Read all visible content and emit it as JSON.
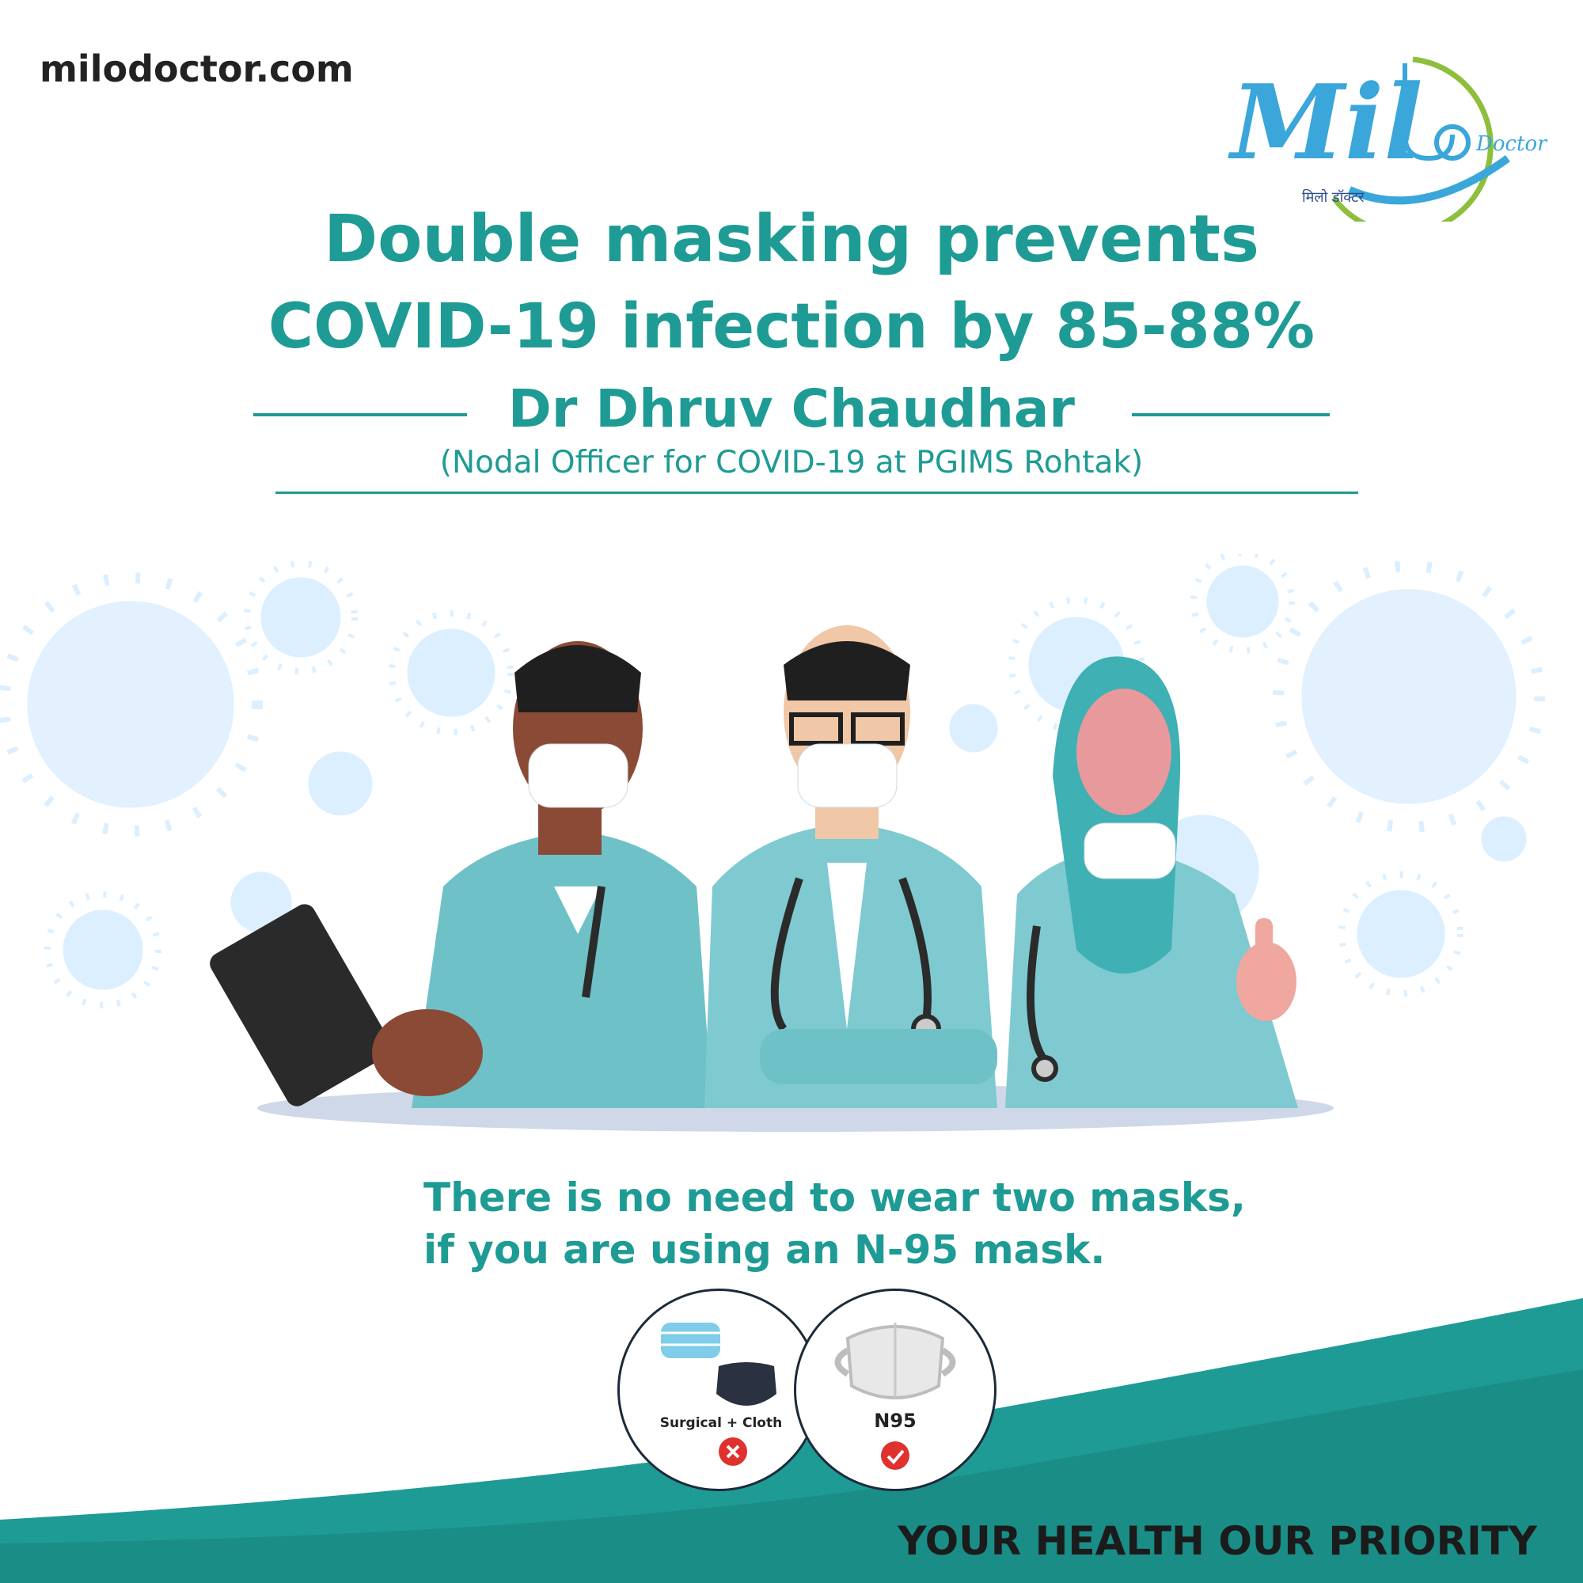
{
  "header": {
    "site_url": "milodoctor.com"
  },
  "logo": {
    "wordmark": "Mil",
    "subtitle": "Doctor",
    "hindi_text": "मिलो डॉक्टर"
  },
  "headline": {
    "line1": "Double masking prevents",
    "line2": "COVID-19 infection by 85-88%"
  },
  "attribution": {
    "name": "Dr Dhruv Chaudhar",
    "role": "(Nodal Officer for COVID-19 at PGIMS Rohtak)"
  },
  "tip": {
    "line1": "There is no need to wear two masks,",
    "line2": "if you are using an N-95 mask."
  },
  "comparison": [
    {
      "label": "Surgical + Cloth",
      "status": "cross-icon"
    },
    {
      "label": "N95",
      "status": "check-icon"
    }
  ],
  "footer": {
    "tagline": "YOUR HEALTH OUR PRIORITY"
  },
  "colors": {
    "brand_teal": "#1e9b94",
    "logo_blue": "#3aa6da",
    "logo_green": "#8dbf3d",
    "scrub_teal": "#7fcad1",
    "virus_blue": "#dcefff",
    "status_red": "#e0312f"
  }
}
